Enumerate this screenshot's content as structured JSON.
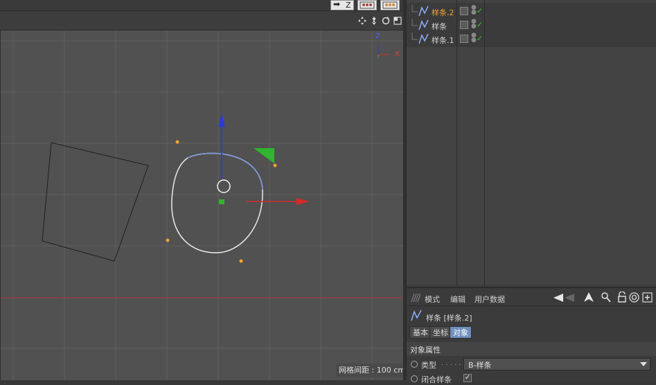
{
  "toolbar": {
    "axis_label": "Z"
  },
  "viewport": {
    "axis_y": "Z",
    "axis_x": "X",
    "grid_spacing_text": "网格间距 : 100 cm"
  },
  "object_manager": {
    "objects": [
      {
        "name": "样条.2",
        "active": true
      },
      {
        "name": "样条",
        "active": false
      },
      {
        "name": "样条.1",
        "active": false
      }
    ]
  },
  "attribute_manager": {
    "menu": [
      "模式",
      "编辑",
      "用户数据"
    ],
    "object_title": "样条 [样条.2]",
    "tabs": [
      {
        "label": "基本",
        "selected": false
      },
      {
        "label": "坐标",
        "selected": false
      },
      {
        "label": "对象",
        "selected": true
      }
    ],
    "section_title": "对象属性",
    "type_label": "类型",
    "type_dots": ". . . . .",
    "type_value": "B-样条",
    "closed_label": "闭合样条"
  },
  "colors": {
    "viewport_bg": "#515151",
    "grid": "#5e5e5e",
    "axis_y": "#2a3bd6",
    "axis_x": "#d62a2a",
    "axis_z": "#2fb52f",
    "selection": "#f0a630",
    "check": "#35c735"
  }
}
